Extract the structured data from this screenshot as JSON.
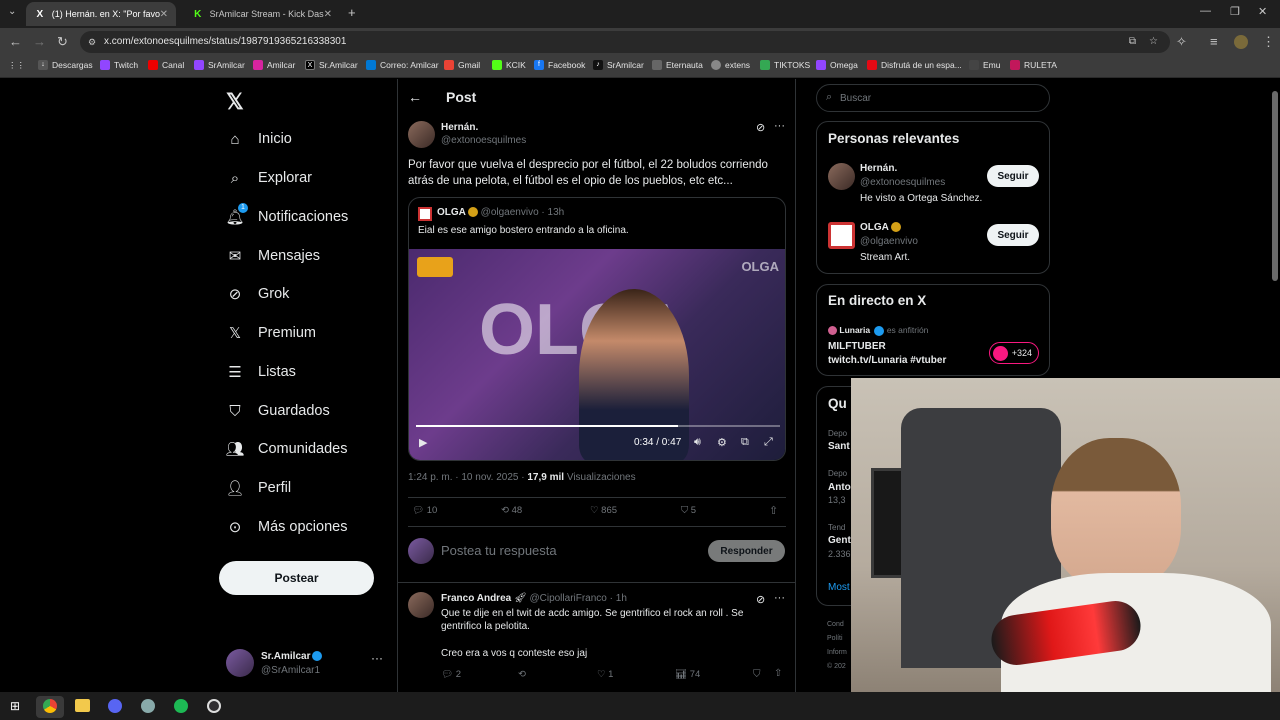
{
  "browser": {
    "tabs": [
      {
        "title": "(1) Hernán. en X: \"Por favo…",
        "favicon": "X"
      },
      {
        "title": "SrAmilcar Stream - Kick Dashbo…",
        "favicon": "K"
      }
    ],
    "url": "x.com/extonoesquilmes/status/1987919365216338301",
    "bookmarks": [
      "Descargas",
      "Twitch",
      "Canal",
      "SrAmilcar",
      "Amilcar",
      "Sr.Amilcar",
      "Correo: Amilcar",
      "Gmail",
      "KCIK",
      "Facebook",
      "SrAmilcar",
      "Eternauta",
      "extens",
      "TIKTOKS",
      "Omega",
      "Disfrutá de un espa...",
      "Emu",
      "RULETA"
    ]
  },
  "nav": {
    "items": [
      "Inicio",
      "Explorar",
      "Notificaciones",
      "Mensajes",
      "Grok",
      "Premium",
      "Listas",
      "Guardados",
      "Comunidades",
      "Perfil",
      "Más opciones"
    ],
    "notif_badge": "1",
    "post_label": "Postear",
    "account": {
      "name": "Sr.Amilcar",
      "handle": "@SrAmilcar1"
    }
  },
  "header": {
    "title": "Post"
  },
  "post": {
    "author": "Hernán.",
    "handle": "@extonoesquilmes",
    "text": "Por favor que vuelva el desprecio por el fútbol, el 22 boludos corriendo atrás de una pelota, el fútbol es el opio de los pueblos, etc etc...",
    "quote": {
      "author": "OLGA",
      "handle": "@olgaenvivo",
      "time": "· 13h",
      "text": "Eial es ese amigo bostero entrando a la oficina.",
      "video_watermark": "OLGA",
      "video_time": "0:34 / 0:47",
      "video_progress": 0.72
    },
    "timestamp": "1:24 p. m. · 10 nov. 2025 ·",
    "views_count": "17,9 mil",
    "views_label": "Visualizaciones",
    "stats": {
      "replies": "10",
      "reposts": "48",
      "likes": "865",
      "bookmarks": "5"
    }
  },
  "reply_box": {
    "placeholder": "Postea tu respuesta",
    "button": "Responder"
  },
  "reply": {
    "author": "Franco Andrea",
    "handle": "@CipollariFranco",
    "time": "· 1h",
    "text1": "Que te dije en el twit de acdc amigo. Se gentrifico el rock an roll . Se gentrifico la pelotita.",
    "text2": "Creo era a vos q conteste eso jaj",
    "stats": {
      "replies": "2",
      "likes": "1",
      "views": "74"
    }
  },
  "right": {
    "search_placeholder": "Buscar",
    "relevant_title": "Personas relevantes",
    "people": [
      {
        "name": "Hernán.",
        "handle": "@extonoesquilmes",
        "bio": "He visto a Ortega Sánchez.",
        "button": "Seguir"
      },
      {
        "name": "OLGA",
        "handle": "@olgaenvivo",
        "bio": "Stream Art.",
        "button": "Seguir"
      }
    ],
    "live_title": "En directo en X",
    "live": {
      "host": "Lunaria",
      "host_suffix": "es anfitrión",
      "title": "MILFTUBER",
      "subtitle": "twitch.tv/Lunaria #vtuber",
      "count": "+324"
    },
    "trending_partial": {
      "header": "Qu",
      "items": [
        "Depo",
        "Sant",
        "Depo",
        "Anto",
        "13,3",
        "Tend",
        "Gent",
        "2.336"
      ],
      "more": "Most"
    },
    "footer_partial": [
      "Cond",
      "Políti",
      "Inform",
      "© 202"
    ]
  }
}
